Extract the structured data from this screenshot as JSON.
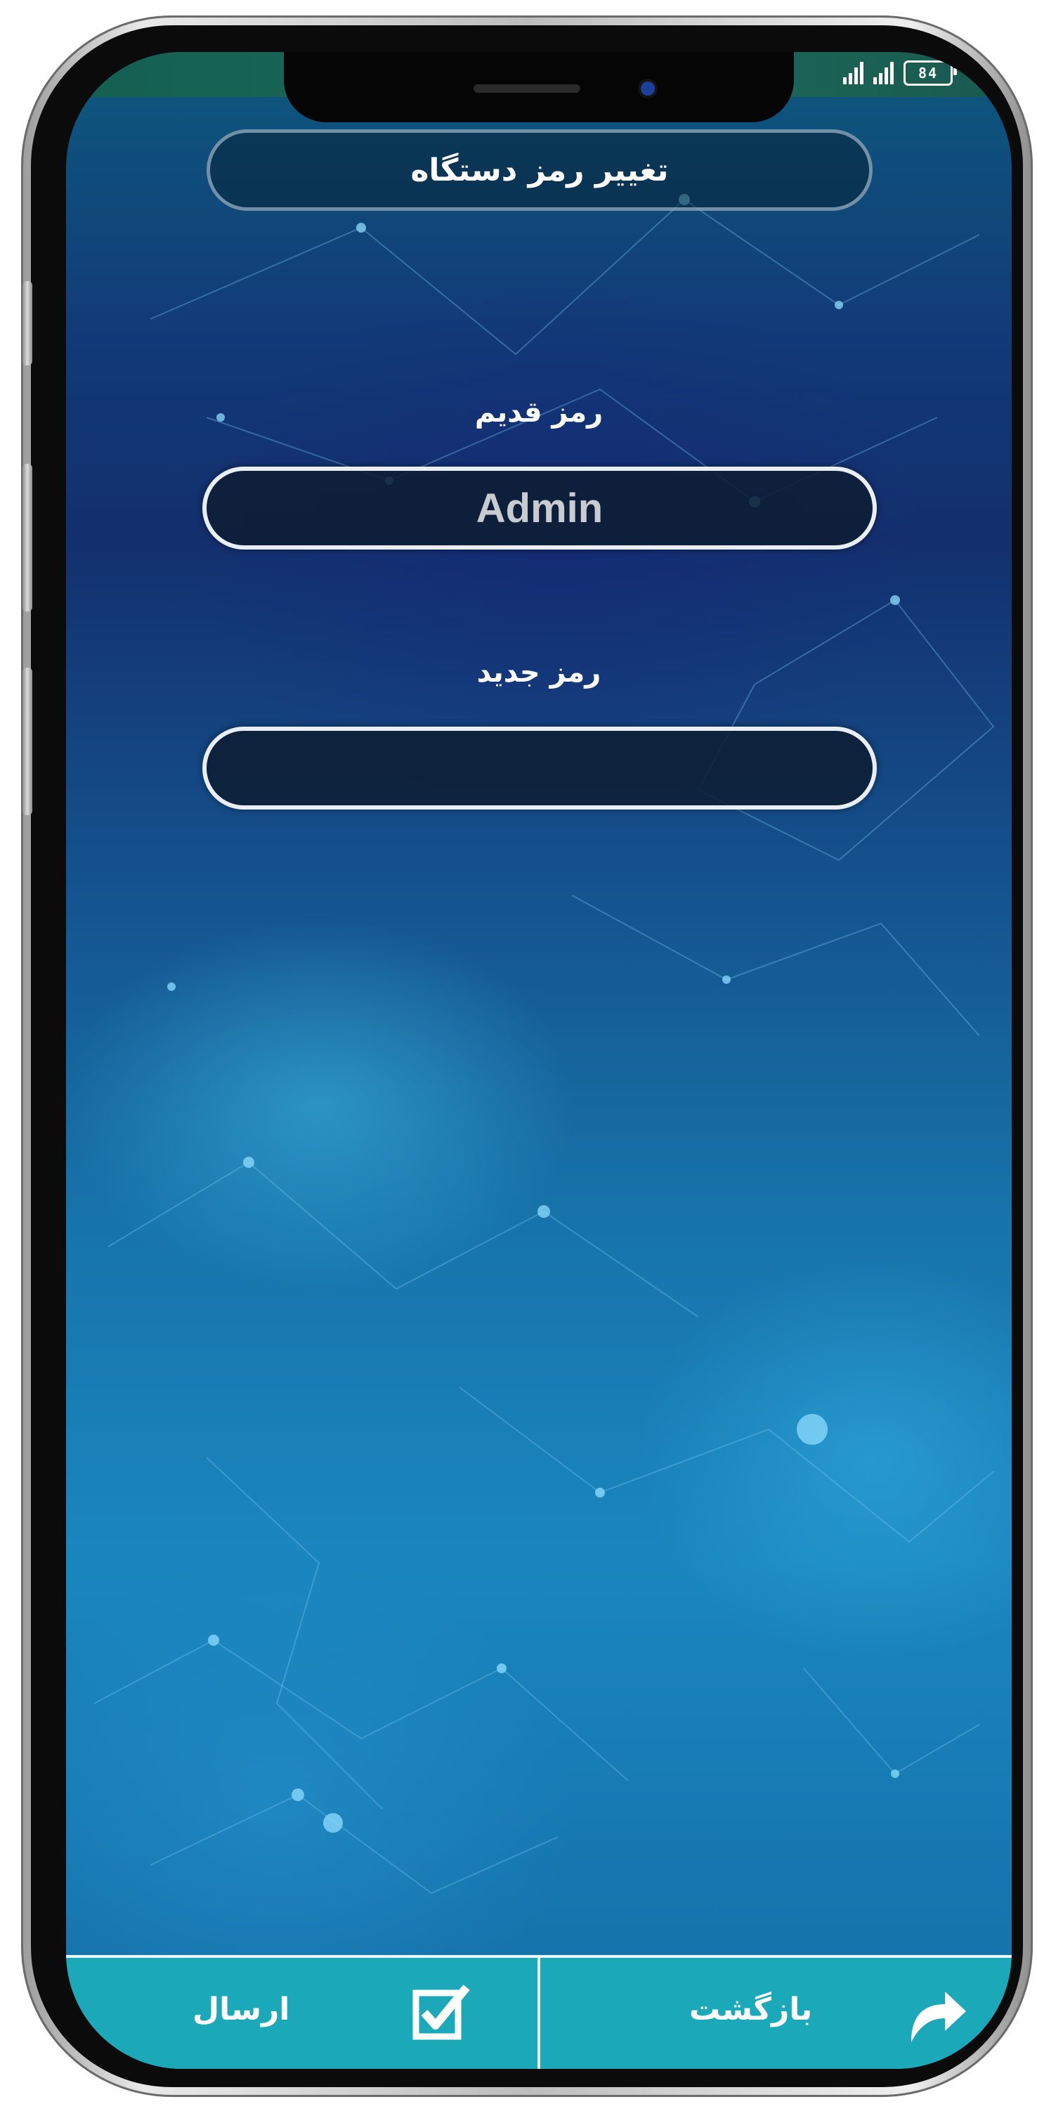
{
  "status_bar": {
    "signal_icons": [
      "signal-bars-icon",
      "signal-bars-icon"
    ],
    "battery_level": "84"
  },
  "header": {
    "title": "تغییر رمز دستگاه"
  },
  "form": {
    "old_password_label": "رمز قدیم",
    "old_password_value": "Admin",
    "new_password_label": "رمز جدید",
    "new_password_value": ""
  },
  "bottom_bar": {
    "submit_label": "ارسال",
    "submit_icon": "checkbox-icon",
    "back_label": "بازگشت",
    "back_icon": "curved-arrow-icon"
  },
  "colors": {
    "bottom_bar": "#1ba9b9",
    "background_dark": "#132f6d",
    "background_light": "#1a86bf"
  }
}
